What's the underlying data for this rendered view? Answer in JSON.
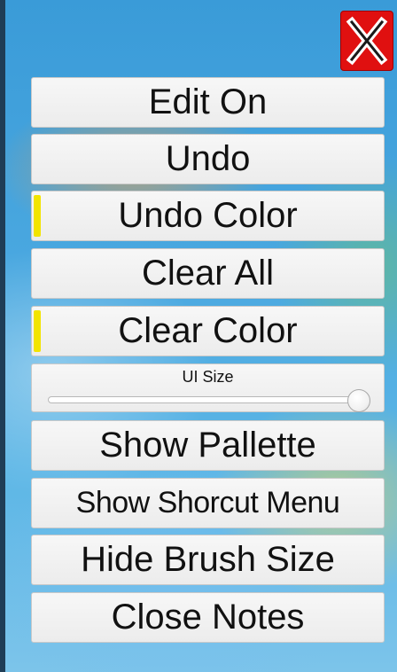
{
  "close_button": {
    "label": "X",
    "color": "#e01010"
  },
  "menu": {
    "edit_on": "Edit On",
    "undo": "Undo",
    "undo_color": {
      "label": "Undo Color",
      "swatch": "#f2e400"
    },
    "clear_all": "Clear All",
    "clear_color": {
      "label": "Clear Color",
      "swatch": "#f2e400"
    },
    "ui_size": {
      "label": "UI Size",
      "value": 0.97
    },
    "show_pallette": "Show Pallette",
    "show_shortcut_menu": "Show Shorcut Menu",
    "hide_brush_size": "Hide Brush Size",
    "close_notes": "Close Notes"
  }
}
